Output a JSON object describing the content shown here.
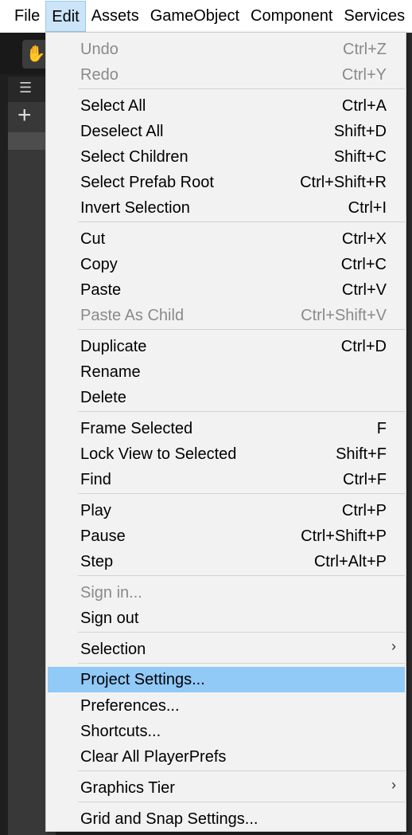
{
  "menubar": {
    "items": [
      "File",
      "Edit",
      "Assets",
      "GameObject",
      "Component",
      "Services"
    ],
    "active": "Edit"
  },
  "editor": {
    "hand_tool_glyph": "✋",
    "hierarchy_tab_glyph": "☰",
    "add_glyph": "+"
  },
  "edit_menu": {
    "undo": {
      "label": "Undo",
      "shortcut": "Ctrl+Z"
    },
    "redo": {
      "label": "Redo",
      "shortcut": "Ctrl+Y"
    },
    "select_all": {
      "label": "Select All",
      "shortcut": "Ctrl+A"
    },
    "deselect_all": {
      "label": "Deselect All",
      "shortcut": "Shift+D"
    },
    "select_children": {
      "label": "Select Children",
      "shortcut": "Shift+C"
    },
    "select_prefab_root": {
      "label": "Select Prefab Root",
      "shortcut": "Ctrl+Shift+R"
    },
    "invert_selection": {
      "label": "Invert Selection",
      "shortcut": "Ctrl+I"
    },
    "cut": {
      "label": "Cut",
      "shortcut": "Ctrl+X"
    },
    "copy": {
      "label": "Copy",
      "shortcut": "Ctrl+C"
    },
    "paste": {
      "label": "Paste",
      "shortcut": "Ctrl+V"
    },
    "paste_as_child": {
      "label": "Paste As Child",
      "shortcut": "Ctrl+Shift+V"
    },
    "duplicate": {
      "label": "Duplicate",
      "shortcut": "Ctrl+D"
    },
    "rename": {
      "label": "Rename"
    },
    "delete": {
      "label": "Delete"
    },
    "frame_selected": {
      "label": "Frame Selected",
      "shortcut": "F"
    },
    "lock_view": {
      "label": "Lock View to Selected",
      "shortcut": "Shift+F"
    },
    "find": {
      "label": "Find",
      "shortcut": "Ctrl+F"
    },
    "play": {
      "label": "Play",
      "shortcut": "Ctrl+P"
    },
    "pause": {
      "label": "Pause",
      "shortcut": "Ctrl+Shift+P"
    },
    "step": {
      "label": "Step",
      "shortcut": "Ctrl+Alt+P"
    },
    "sign_in": {
      "label": "Sign in..."
    },
    "sign_out": {
      "label": "Sign out"
    },
    "selection": {
      "label": "Selection"
    },
    "project_settings": {
      "label": "Project Settings..."
    },
    "preferences": {
      "label": "Preferences..."
    },
    "shortcuts": {
      "label": "Shortcuts..."
    },
    "clear_playerprefs": {
      "label": "Clear All PlayerPrefs"
    },
    "graphics_tier": {
      "label": "Graphics Tier"
    },
    "grid_snap": {
      "label": "Grid and Snap Settings..."
    },
    "submenu_glyph": "›"
  },
  "colors": {
    "menu_bg": "#f2f2f2",
    "highlight": "#91c9f7",
    "active_menubar": "#cce4f7",
    "disabled_text": "#8a8a8a"
  }
}
